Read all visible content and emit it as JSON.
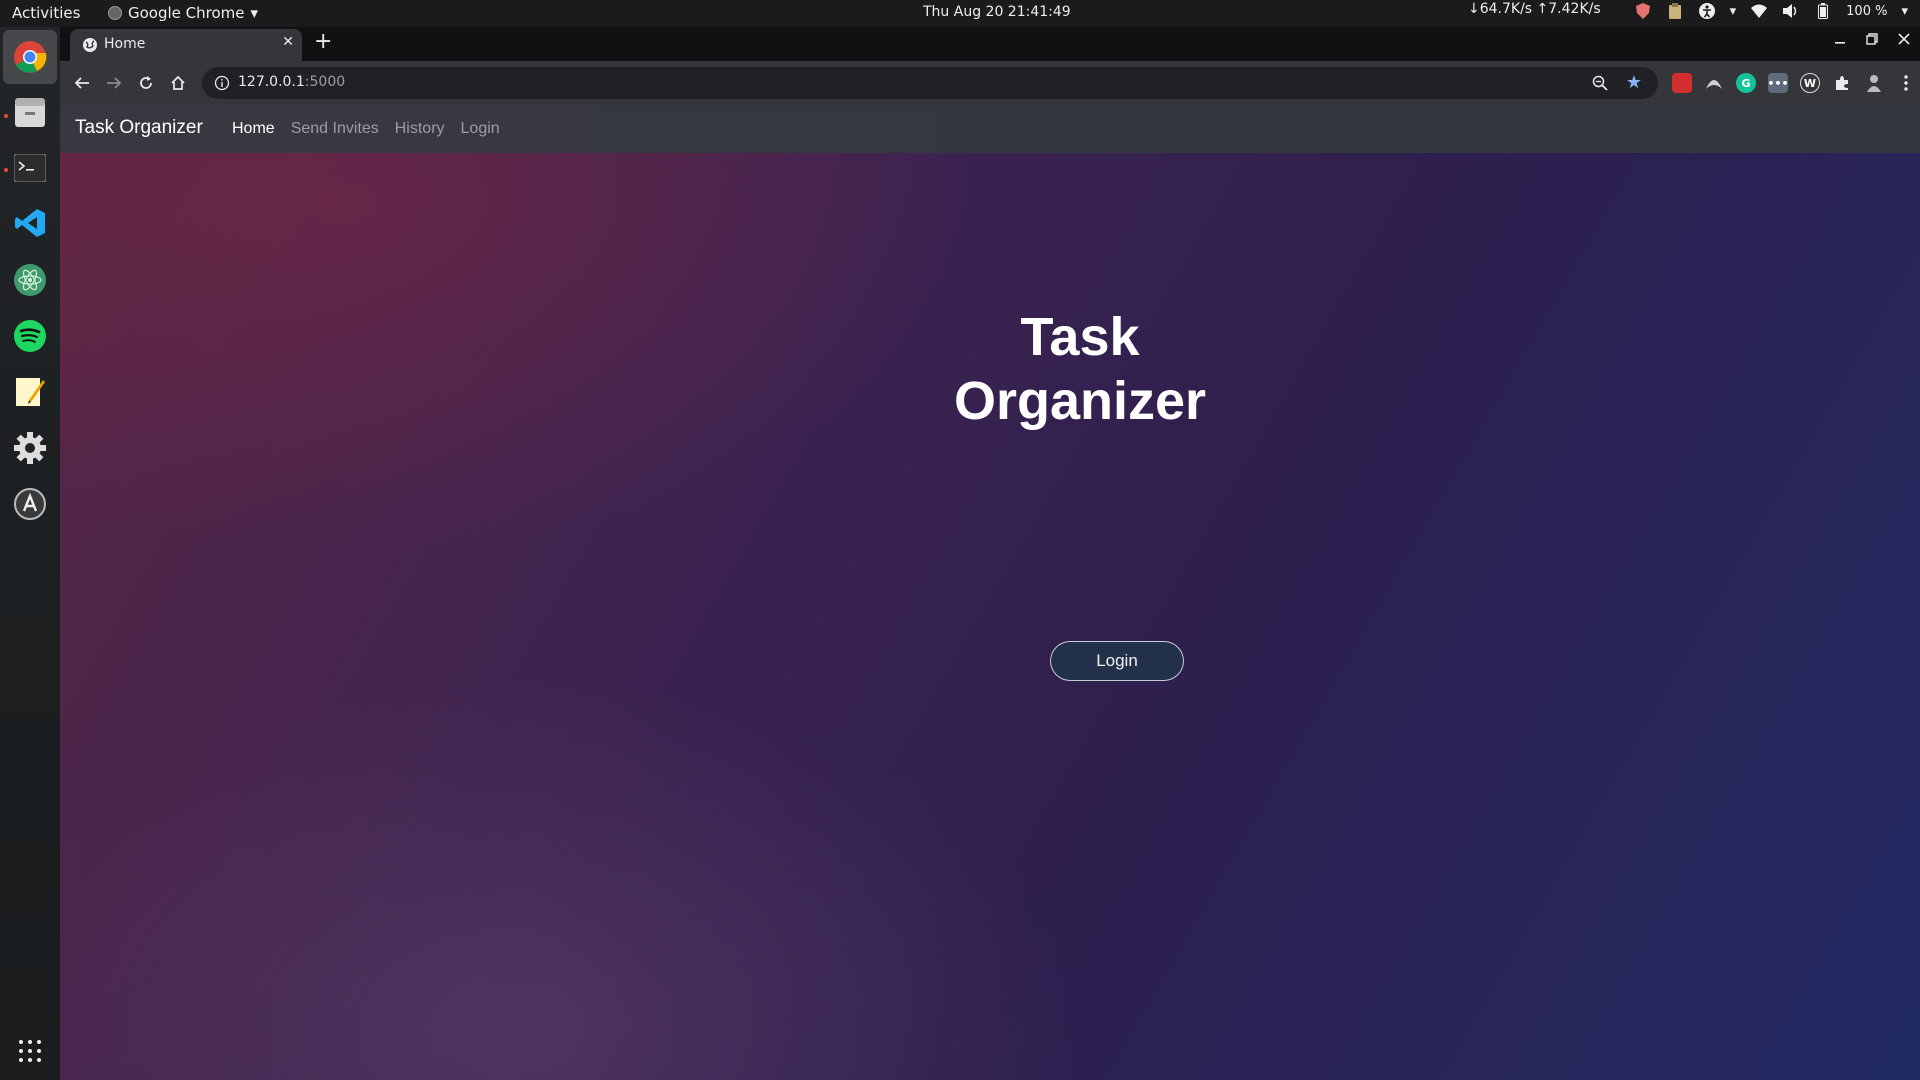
{
  "system": {
    "activities_label": "Activities",
    "app_menu_label": "Google Chrome",
    "clock": "Thu Aug 20  21:41:49",
    "net_speed": "↓64.7K/s ↑7.42K/s",
    "battery": "100 %"
  },
  "dock": {
    "apps": [
      "chrome-icon",
      "files-icon",
      "terminal-icon",
      "vscode-icon",
      "atom-icon",
      "spotify-icon",
      "text-editor-icon",
      "settings-icon",
      "software-updater-icon",
      "app-grid-icon"
    ]
  },
  "browser": {
    "tab_title": "Home",
    "url_host": "127.0.0.1",
    "url_port": ":5000",
    "new_tab_symbol": "+",
    "close_tab_symbol": "✕"
  },
  "navbar": {
    "brand": "Task Organizer",
    "links": [
      "Home",
      "Send Invites",
      "History",
      "Login"
    ],
    "active": "Home"
  },
  "hero": {
    "title_line1": "Task",
    "title_line2": "Organizer",
    "login_button": "Login"
  },
  "colors": {
    "navbar_bg": "#343a40",
    "button_bg": "#23304a",
    "gradient_start": "#5a2744",
    "gradient_end": "#222a63"
  }
}
